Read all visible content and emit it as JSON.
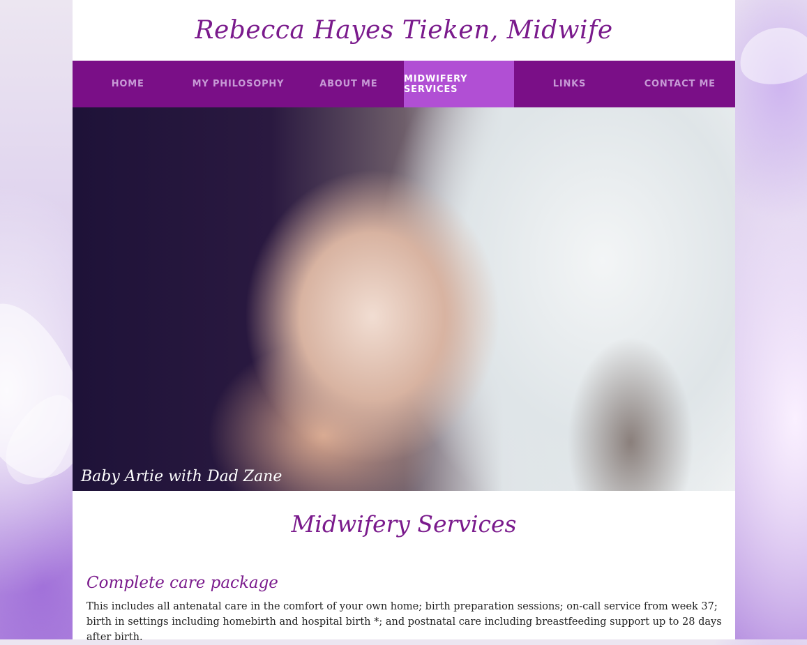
{
  "site": {
    "title": "Rebecca Hayes Tieken, Midwife"
  },
  "nav": {
    "items": [
      {
        "label": "HOME",
        "active": false
      },
      {
        "label": "MY PHILOSOPHY",
        "active": false
      },
      {
        "label": "ABOUT ME",
        "active": false
      },
      {
        "label": "MIDWIFERY SERVICES",
        "active": true
      },
      {
        "label": "LINKS",
        "active": false
      },
      {
        "label": "CONTACT ME",
        "active": false
      }
    ]
  },
  "hero": {
    "caption": "Baby Artie with Dad Zane"
  },
  "main": {
    "heading": "Midwifery Services",
    "sections": [
      {
        "heading": "Complete care package",
        "body": "This includes all antenatal care in the comfort of your own home; birth preparation sessions; on-call service from week 37; birth in settings including homebirth and hospital birth *; and postnatal care including breastfeeding support up to 28 days after birth."
      }
    ]
  },
  "colors": {
    "brand_purple": "#7a0f87",
    "active_tab": "#b14fd4",
    "heading_text": "#7a1a8c"
  }
}
